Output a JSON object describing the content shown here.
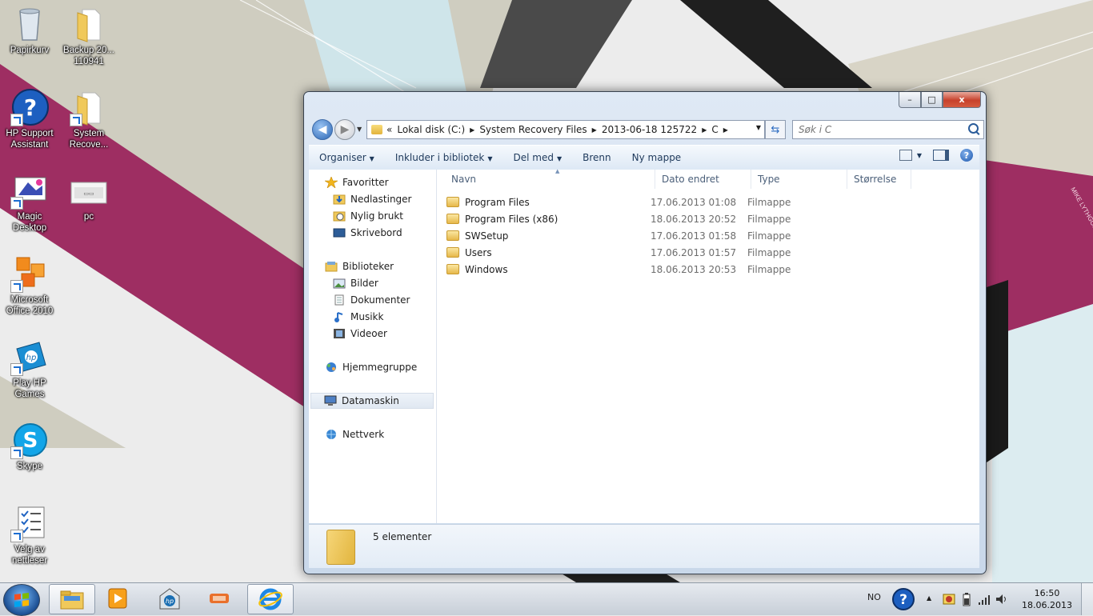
{
  "desktop": {
    "icons": [
      {
        "label": "Papirkurv",
        "icon": "recycle-bin-icon"
      },
      {
        "label": "Backup 20... 110941",
        "icon": "folder-icon"
      },
      {
        "label": "HP Support Assistant",
        "icon": "help-question-icon"
      },
      {
        "label": "System Recove...",
        "icon": "folder-icon"
      },
      {
        "label": "Magic Desktop",
        "icon": "magic-desktop-icon"
      },
      {
        "label": "pc",
        "icon": "pc-icon"
      },
      {
        "label": "Microsoft Office 2010",
        "icon": "office-icon"
      },
      {
        "label": "Play HP Games",
        "icon": "hp-games-icon"
      },
      {
        "label": "Skype",
        "icon": "skype-icon"
      },
      {
        "label": "Velg av nettleser",
        "icon": "browser-choice-icon"
      }
    ],
    "wallpaper_signature": "MIKE LYTHGOE"
  },
  "window": {
    "caption_buttons": {
      "minimize": "–",
      "maximize": "□",
      "close": "x"
    },
    "address": {
      "overflow": "«",
      "crumbs": [
        "Lokal disk (C:)",
        "System Recovery Files",
        "2013-06-18 125722",
        "C"
      ]
    },
    "search": {
      "placeholder": "Søk i C"
    },
    "toolbar": {
      "organize": "Organiser",
      "include_in_library": "Inkluder i bibliotek",
      "share_with": "Del med",
      "burn": "Brenn",
      "new_folder": "Ny mappe"
    },
    "nav": {
      "favorites": "Favoritter",
      "downloads": "Nedlastinger",
      "recent": "Nylig brukt",
      "desktop": "Skrivebord",
      "libraries": "Biblioteker",
      "pictures": "Bilder",
      "documents": "Dokumenter",
      "music": "Musikk",
      "videos": "Videoer",
      "homegroup": "Hjemmegruppe",
      "computer": "Datamaskin",
      "network": "Nettverk"
    },
    "columns": {
      "name": "Navn",
      "date": "Dato endret",
      "type": "Type",
      "size": "Størrelse"
    },
    "files": [
      {
        "name": "Program Files",
        "date": "17.06.2013 01:08",
        "type": "Filmappe"
      },
      {
        "name": "Program Files (x86)",
        "date": "18.06.2013 20:52",
        "type": "Filmappe"
      },
      {
        "name": "SWSetup",
        "date": "17.06.2013 01:58",
        "type": "Filmappe"
      },
      {
        "name": "Users",
        "date": "17.06.2013 01:57",
        "type": "Filmappe"
      },
      {
        "name": "Windows",
        "date": "18.06.2013 20:53",
        "type": "Filmappe"
      }
    ],
    "details": {
      "count": "5 elementer"
    }
  },
  "taskbar": {
    "pinned": [
      "explorer-icon",
      "media-player-icon",
      "hp-icon",
      "hp-games-icon",
      "internet-explorer-icon"
    ],
    "language": "NO",
    "time": "16:50",
    "date": "18.06.2013"
  }
}
